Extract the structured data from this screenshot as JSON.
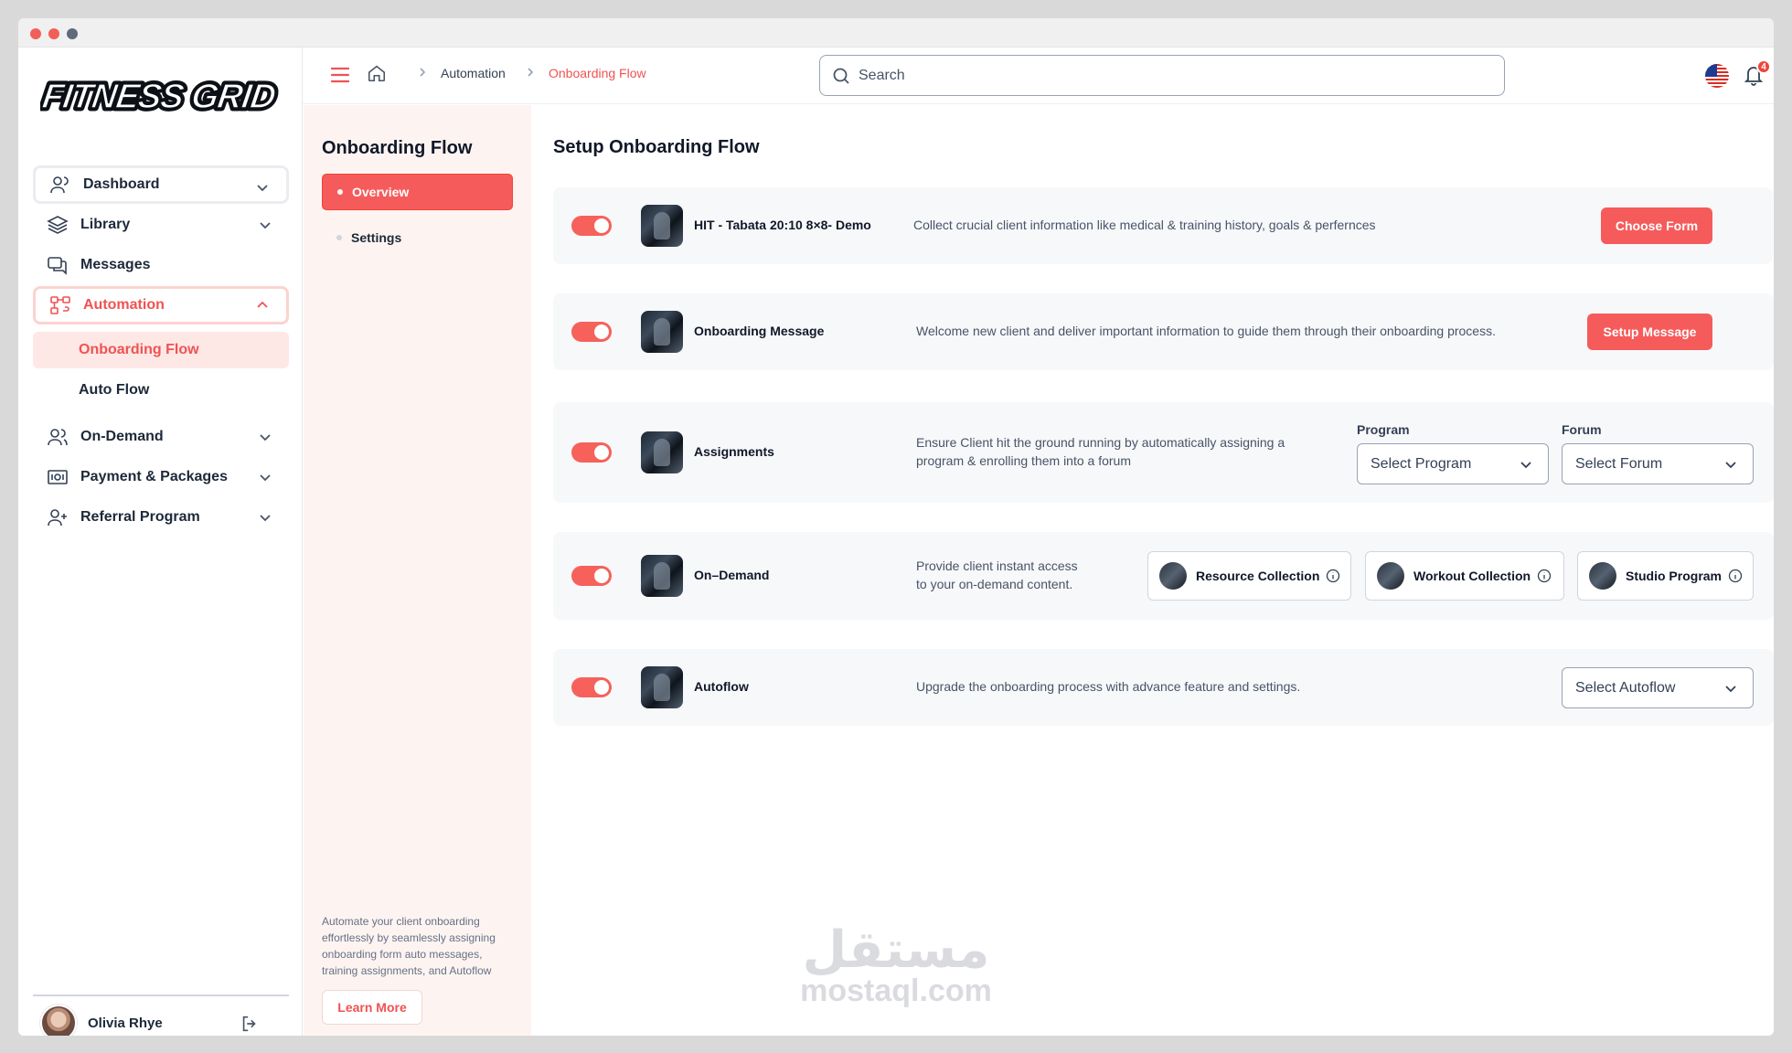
{
  "app": {
    "logo_text": "FITNESS GRID",
    "accent_color": "#f65b5b"
  },
  "sidebar": {
    "items": [
      {
        "label": "Dashboard",
        "icon": "user-icon"
      },
      {
        "label": "Library",
        "icon": "layers-icon"
      },
      {
        "label": "Messages",
        "icon": "chat-icon"
      },
      {
        "label": "Automation",
        "icon": "flow-icon"
      },
      {
        "label": "On-Demand",
        "icon": "users-icon"
      },
      {
        "label": "Payment & Packages",
        "icon": "money-icon"
      },
      {
        "label": "Referral Program",
        "icon": "user-plus-icon"
      }
    ],
    "subitems": [
      {
        "label": "Onboarding Flow"
      },
      {
        "label": "Auto Flow"
      }
    ],
    "user": {
      "name": "Olivia Rhye"
    }
  },
  "topbar": {
    "breadcrumb": [
      "Automation",
      "Onboarding Flow"
    ],
    "search_placeholder": "Search",
    "notification_count": "4"
  },
  "panel": {
    "title": "Onboarding Flow",
    "tabs": [
      {
        "label": "Overview",
        "active": true
      },
      {
        "label": "Settings",
        "active": false
      }
    ],
    "note": "Automate your client onboarding effortlessly by seamlessly assigning onboarding form auto messages, training assignments, and Autoflow",
    "learn_more": "Learn More"
  },
  "main": {
    "title": "Setup Onboarding Flow",
    "cards": [
      {
        "name": "HIT - Tabata 20:10 8×8- Demo",
        "description": "Collect crucial client information like medical & training history, goals & perfernces",
        "button": "Choose Form",
        "enabled": true
      },
      {
        "name": "Onboarding Message",
        "description": "Welcome new client and deliver important information to guide them through their onboarding process.",
        "button": "Setup Message",
        "enabled": true
      },
      {
        "name": "Assignments",
        "description": "Ensure Client hit the ground running by automatically assigning a program & enrolling them into a forum",
        "program_label": "Program",
        "program_value": "Select Program",
        "forum_label": "Forum",
        "forum_value": "Select Forum",
        "enabled": true
      },
      {
        "name": "On–Demand",
        "description_line1": "Provide client instant access",
        "description_line2": "to your on-demand content.",
        "chips": [
          "Resource Collection",
          "Workout Collection",
          "Studio Program"
        ],
        "enabled": true
      },
      {
        "name": "Autoflow",
        "description": "Upgrade the onboarding process with advance feature and settings.",
        "select_value": "Select Autoflow",
        "enabled": true
      }
    ]
  },
  "watermark": {
    "arabic": "مستقل",
    "latin": "mostaql.com"
  }
}
